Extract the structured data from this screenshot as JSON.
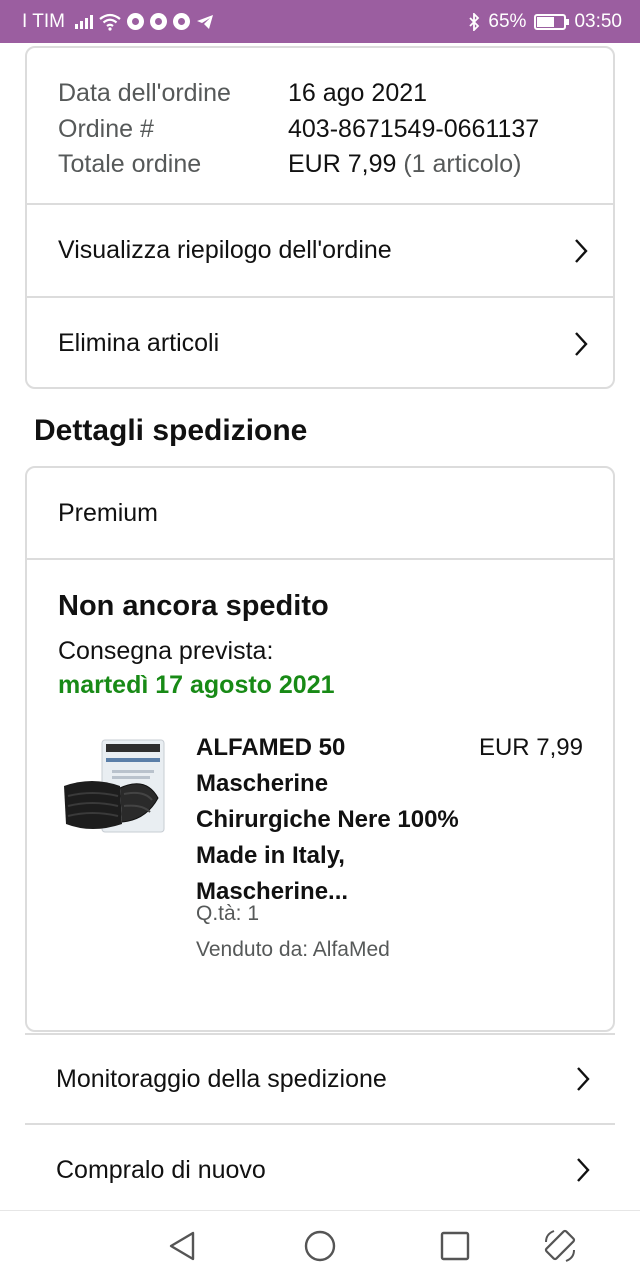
{
  "status_bar": {
    "carrier": "TIM",
    "battery": "65%",
    "battery_level": 0.65,
    "time": "03:50",
    "icons": [
      "signal-icon",
      "wifi-icon",
      "chrome-icon",
      "chrome-icon",
      "chrome-icon",
      "telegram-icon",
      "bluetooth-icon",
      "battery-icon"
    ]
  },
  "order_info": {
    "rows": [
      {
        "label": "Data dell'ordine",
        "value": "16 ago 2021",
        "extra": ""
      },
      {
        "label": "Ordine #",
        "value": "403-8671549-0661137",
        "extra": ""
      },
      {
        "label": "Totale ordine",
        "value": "EUR 7,99",
        "extra": " (1 articolo)"
      }
    ],
    "links": [
      "Visualizza riepilogo dell'ordine",
      "Elimina articoli"
    ]
  },
  "shipping": {
    "section_title": "Dettagli spedizione",
    "type": "Premium",
    "status": "Non ancora spedito",
    "expected_label": "Consegna prevista:",
    "expected_date": "martedì 17 agosto 2021",
    "date_color": "#188a16",
    "product": {
      "title": "ALFAMED 50 Mascherine Chirurgiche Nere 100% Made in Italy, Mascherine...",
      "price": "EUR 7,99",
      "qty": "Q.tà: 1",
      "seller": "Venduto da: AlfaMed",
      "thumb_brand": "AlfaMed"
    }
  },
  "actions": [
    "Monitoraggio della spedizione",
    "Compralo di nuovo"
  ],
  "nav": [
    "back-icon",
    "home-icon",
    "recents-icon",
    "rotate-icon"
  ]
}
